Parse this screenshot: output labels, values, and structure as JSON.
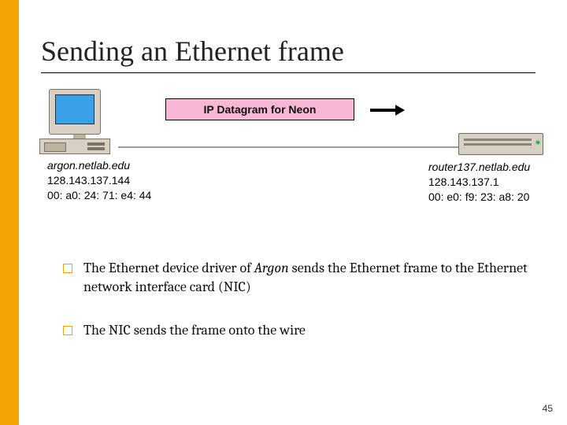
{
  "title": "Sending an Ethernet frame",
  "diagram": {
    "argon": {
      "hostname": "argon.netlab.edu",
      "ip": "128.143.137.144",
      "mac": "00: a0: 24: 71: e4: 44"
    },
    "datagram_label": "IP Datagram for Neon",
    "router": {
      "hostname": "router137.netlab.edu",
      "ip": "128.143.137.1",
      "mac": "00: e0: f9: 23: a8: 20"
    }
  },
  "bullets": {
    "b1_pre": "The Ethernet device driver of ",
    "b1_italic": "Argon",
    "b1_post": " sends the Ethernet frame to the Ethernet network interface card (NIC)",
    "b2": "The NIC sends the frame onto the wire"
  },
  "page_number": "45"
}
